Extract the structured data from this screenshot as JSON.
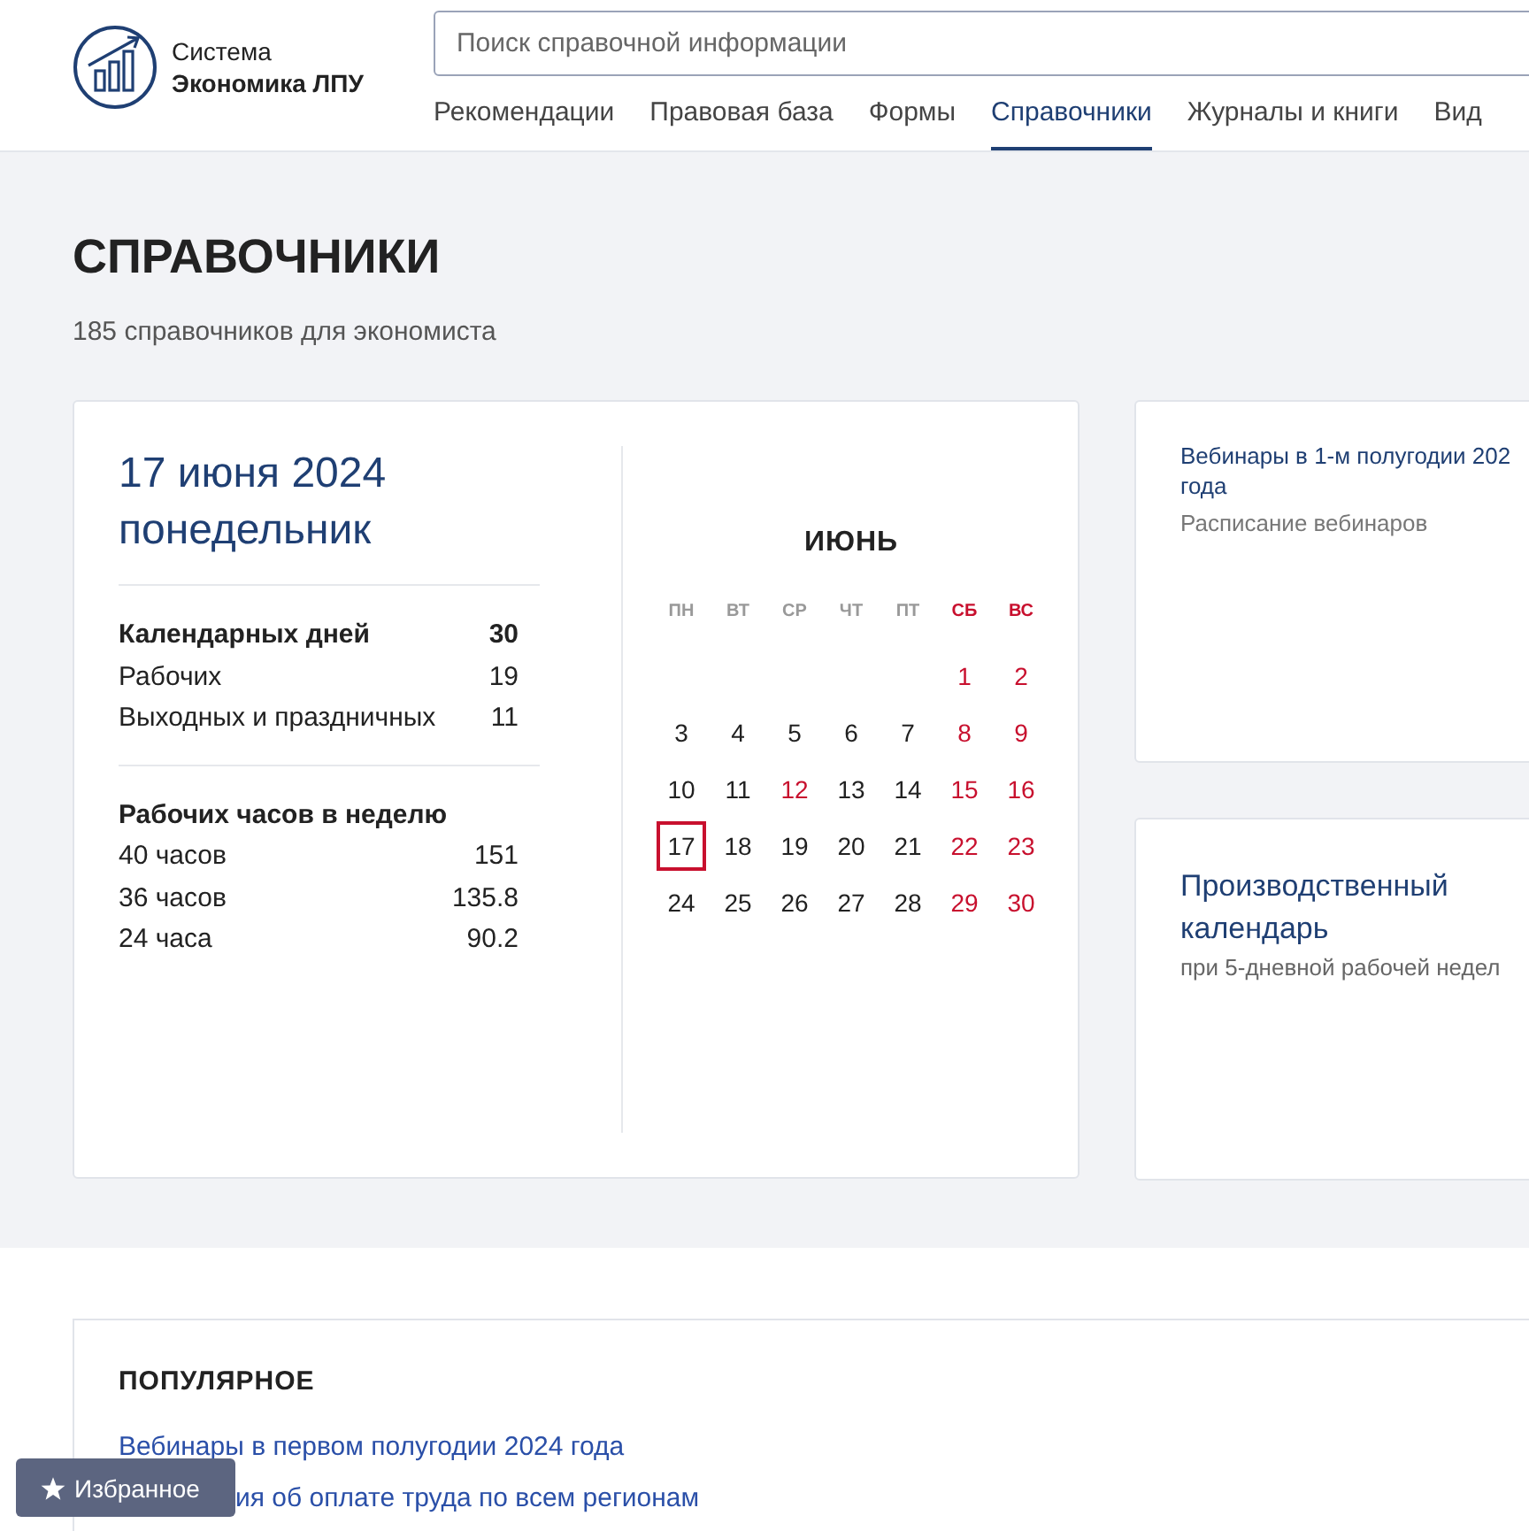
{
  "logo": {
    "line1": "Система",
    "line2": "Экономика ЛПУ"
  },
  "search": {
    "placeholder": "Поиск справочной информации"
  },
  "nav": [
    {
      "label": "Рекомендации",
      "selected": false
    },
    {
      "label": "Правовая база",
      "selected": false
    },
    {
      "label": "Формы",
      "selected": false
    },
    {
      "label": "Справочники",
      "selected": true
    },
    {
      "label": "Журналы и книги",
      "selected": false
    },
    {
      "label": "Вид",
      "selected": false
    }
  ],
  "page": {
    "title": "СПРАВОЧНИКИ",
    "subtitle": "185 справочников для экономиста"
  },
  "date_card": {
    "date": "17 июня 2024",
    "weekday": "понедельник",
    "days": [
      {
        "label": "Календарных дней",
        "value": "30",
        "bold": true
      },
      {
        "label": "Рабочих",
        "value": "19",
        "bold": false
      },
      {
        "label": "Выходных и праздничных",
        "value": "11",
        "bold": false
      }
    ],
    "hours_title": "Рабочих часов в неделю",
    "hours": [
      {
        "label": "40 часов",
        "value": "151"
      },
      {
        "label": "36 часов",
        "value": "135.8"
      },
      {
        "label": "24 часа",
        "value": "90.2"
      }
    ]
  },
  "calendar": {
    "month": "ИЮНЬ",
    "weekdays": [
      {
        "label": "ПН",
        "weekend": false
      },
      {
        "label": "ВТ",
        "weekend": false
      },
      {
        "label": "СР",
        "weekend": false
      },
      {
        "label": "ЧТ",
        "weekend": false
      },
      {
        "label": "ПТ",
        "weekend": false
      },
      {
        "label": "СБ",
        "weekend": true
      },
      {
        "label": "ВС",
        "weekend": true
      }
    ],
    "weeks": [
      [
        {
          "kind": "blank"
        },
        {
          "kind": "blank"
        },
        {
          "kind": "blank"
        },
        {
          "kind": "blank"
        },
        {
          "kind": "blank"
        },
        {
          "day": "1",
          "weekend": true,
          "selected": false
        },
        {
          "day": "2",
          "weekend": true,
          "selected": false
        }
      ],
      [
        {
          "day": "3",
          "weekend": false,
          "selected": false
        },
        {
          "day": "4",
          "weekend": false,
          "selected": false
        },
        {
          "day": "5",
          "weekend": false,
          "selected": false
        },
        {
          "day": "6",
          "weekend": false,
          "selected": false
        },
        {
          "day": "7",
          "weekend": false,
          "selected": false
        },
        {
          "day": "8",
          "weekend": true,
          "selected": false
        },
        {
          "day": "9",
          "weekend": true,
          "selected": false
        }
      ],
      [
        {
          "day": "10",
          "weekend": false,
          "selected": false
        },
        {
          "day": "11",
          "weekend": false,
          "selected": false
        },
        {
          "day": "12",
          "weekend": true,
          "selected": false
        },
        {
          "day": "13",
          "weekend": false,
          "selected": false
        },
        {
          "day": "14",
          "weekend": false,
          "selected": false
        },
        {
          "day": "15",
          "weekend": true,
          "selected": false
        },
        {
          "day": "16",
          "weekend": true,
          "selected": false
        }
      ],
      [
        {
          "day": "17",
          "weekend": false,
          "selected": true
        },
        {
          "day": "18",
          "weekend": false,
          "selected": false
        },
        {
          "day": "19",
          "weekend": false,
          "selected": false
        },
        {
          "day": "20",
          "weekend": false,
          "selected": false
        },
        {
          "day": "21",
          "weekend": false,
          "selected": false
        },
        {
          "day": "22",
          "weekend": true,
          "selected": false
        },
        {
          "day": "23",
          "weekend": true,
          "selected": false
        }
      ],
      [
        {
          "day": "24",
          "weekend": false,
          "selected": false
        },
        {
          "day": "25",
          "weekend": false,
          "selected": false
        },
        {
          "day": "26",
          "weekend": false,
          "selected": false
        },
        {
          "day": "27",
          "weekend": false,
          "selected": false
        },
        {
          "day": "28",
          "weekend": false,
          "selected": false
        },
        {
          "day": "29",
          "weekend": true,
          "selected": false
        },
        {
          "day": "30",
          "weekend": true,
          "selected": false
        }
      ]
    ]
  },
  "side_cards": [
    {
      "kind": "link",
      "title_lines": [
        "Вебинары в 1-м полугодии 202",
        "года"
      ],
      "subtitle": "Расписание вебинаров"
    },
    {
      "kind": "heading",
      "title_lines": [
        "Производственный",
        "календарь"
      ],
      "subtitle": "при 5-дневной рабочей недел"
    }
  ],
  "popular": {
    "title": "ПОПУЛЯРНОЕ",
    "links": [
      {
        "label": "Вебинары в первом полугодии 2024 года",
        "covered": false
      },
      {
        "label": "ия об оплате труда по всем регионам",
        "covered": true
      }
    ]
  },
  "favorites_button": {
    "label": "Избранное"
  }
}
